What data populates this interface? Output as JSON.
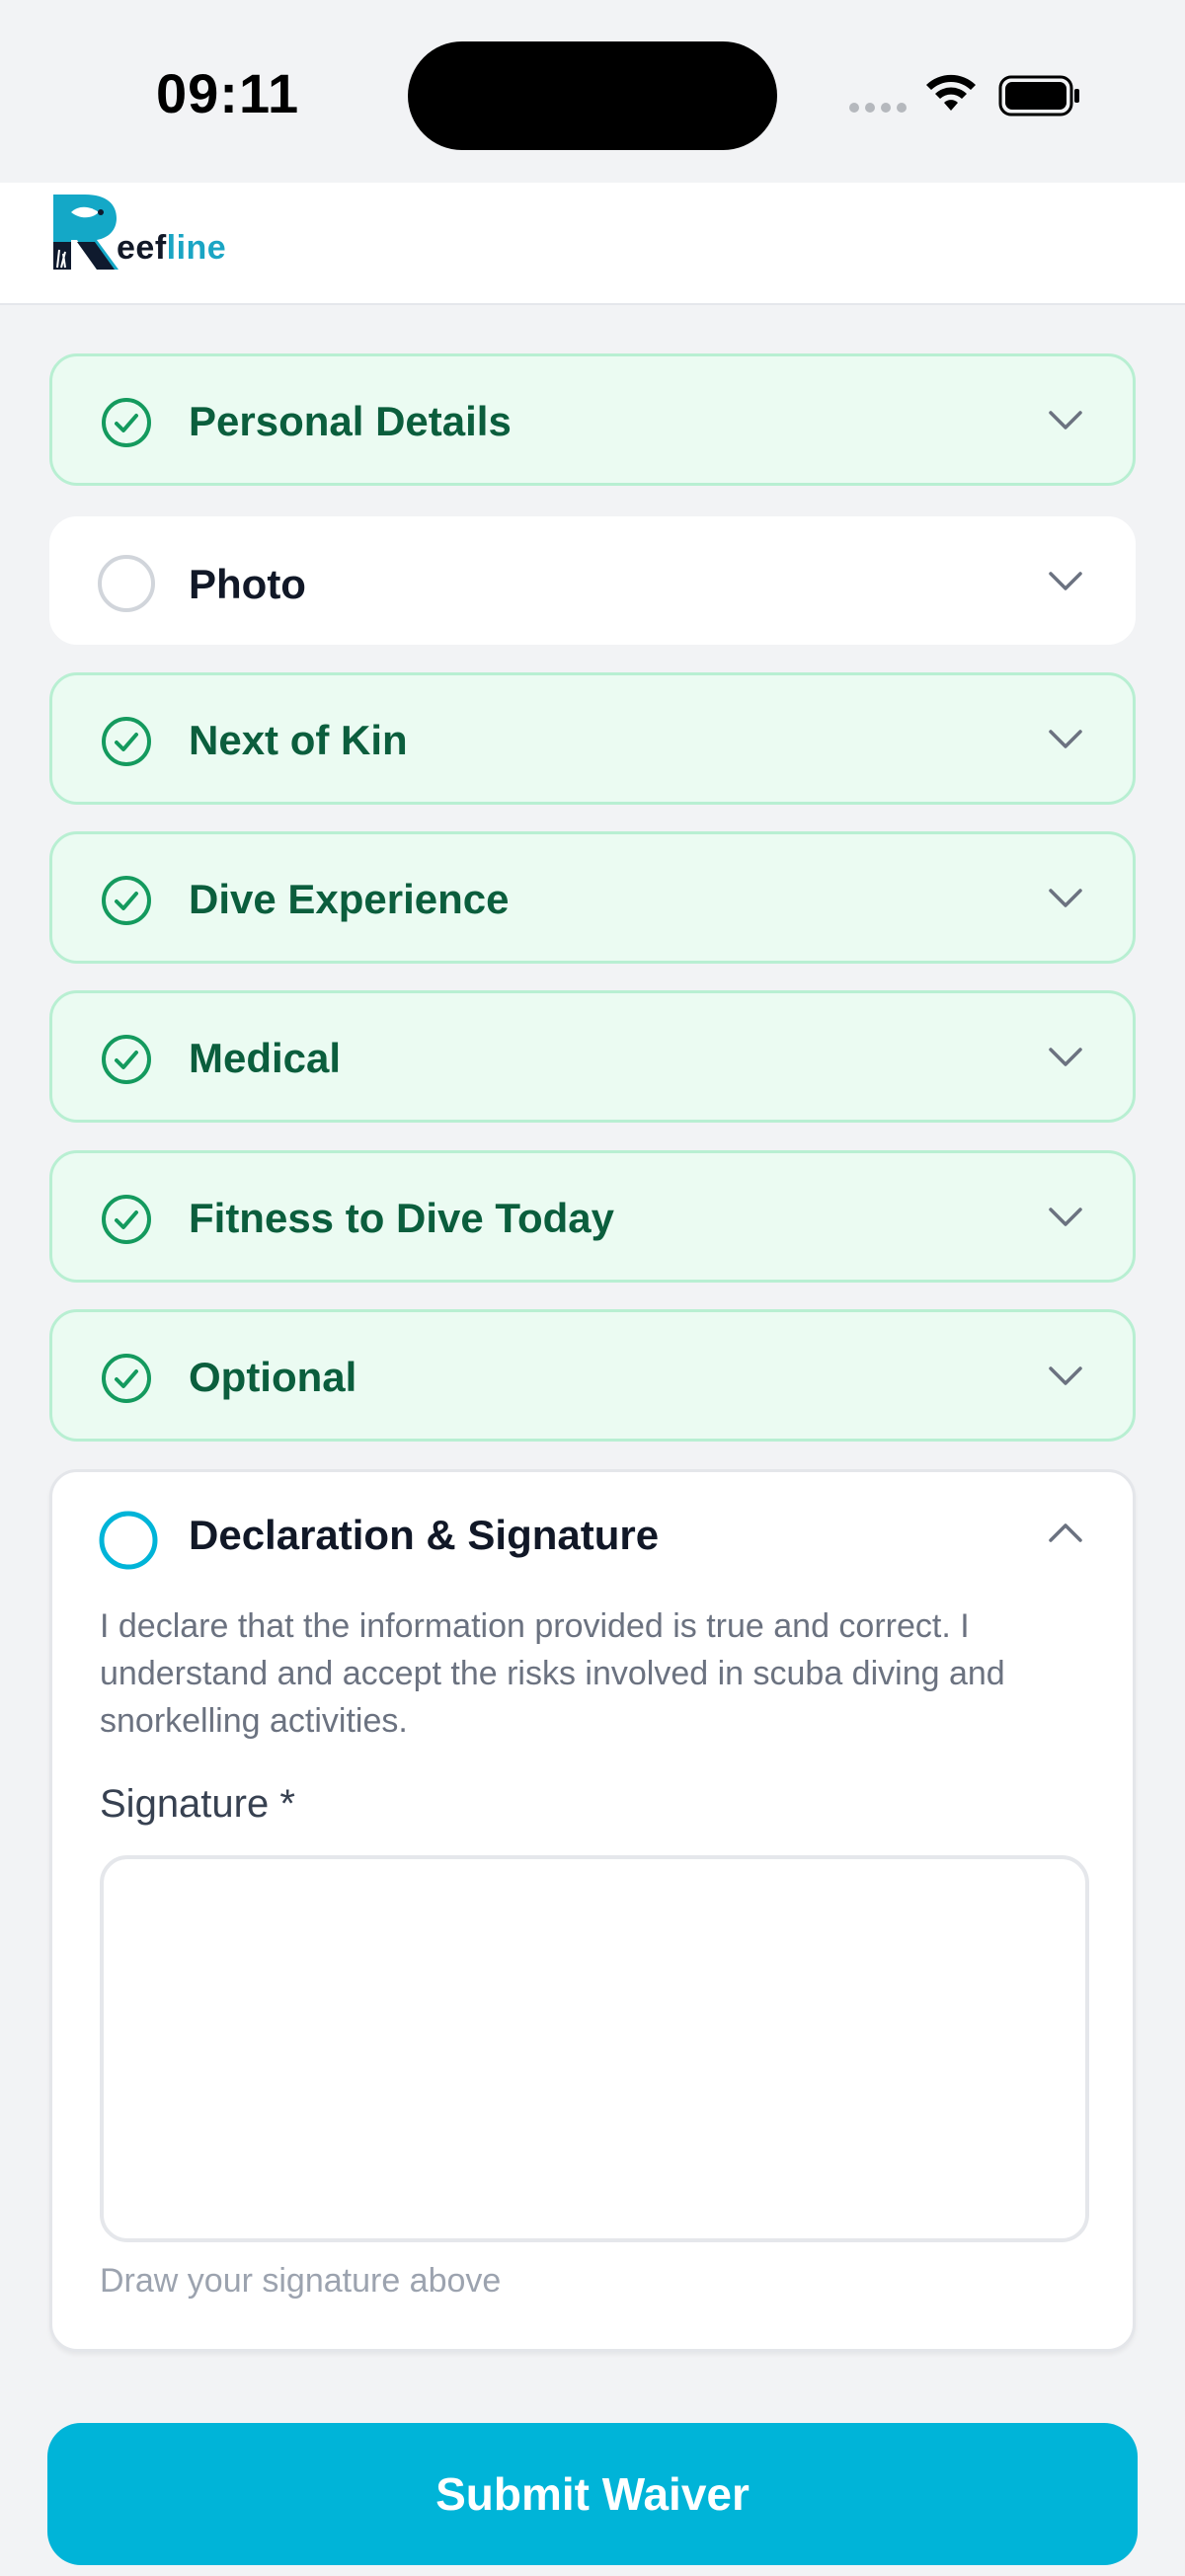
{
  "status_bar": {
    "time": "09:11"
  },
  "header": {
    "logo_text_primary": "eef",
    "logo_text_accent": "line"
  },
  "sections": [
    {
      "label": "Personal Details",
      "state": "complete"
    },
    {
      "label": "Photo",
      "state": "pending"
    },
    {
      "label": "Next of Kin",
      "state": "complete"
    },
    {
      "label": "Dive Experience",
      "state": "complete"
    },
    {
      "label": "Medical",
      "state": "complete"
    },
    {
      "label": "Fitness to Dive Today",
      "state": "complete"
    },
    {
      "label": "Optional",
      "state": "complete"
    }
  ],
  "declaration": {
    "label": "Declaration & Signature",
    "state": "active",
    "text": "I declare that the information provided is true and correct. I understand and accept the risks involved in scuba diving and snorkelling activities.",
    "signature_label": "Signature *",
    "signature_hint": "Draw your signature above"
  },
  "submit": {
    "label": "Submit Waiver"
  },
  "colors": {
    "complete_bg": "#ebfbf2",
    "complete_border": "#b8efd2",
    "complete_text": "#0b5e3d",
    "check": "#149a5e",
    "accent": "#00b4d8"
  },
  "icons": {
    "complete": "check-circle-icon",
    "pending": "empty-circle-icon",
    "collapsed": "chevron-down-icon",
    "expanded": "chevron-up-icon"
  }
}
